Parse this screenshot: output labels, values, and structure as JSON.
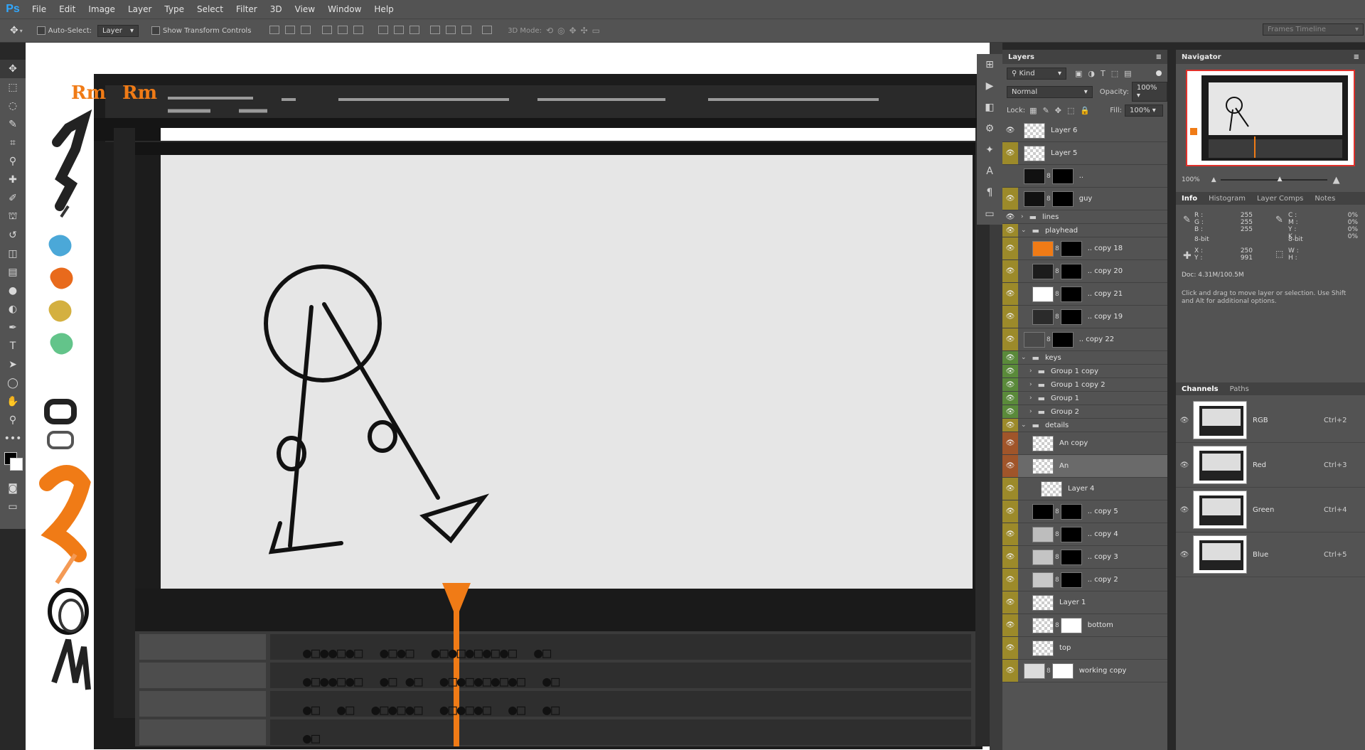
{
  "app": {
    "logo": "Ps"
  },
  "menu": [
    "File",
    "Edit",
    "Image",
    "Layer",
    "Type",
    "Select",
    "Filter",
    "3D",
    "View",
    "Window",
    "Help"
  ],
  "options": {
    "auto_select_label": "Auto-Select:",
    "auto_select_value": "Layer",
    "transform_label": "Show Transform Controls",
    "mode3d_label": "3D Mode:",
    "workspace": "Frames Timeline"
  },
  "layers_panel": {
    "title": "Layers",
    "kind_label": "Kind",
    "blend_mode": "Normal",
    "opacity_label": "Opacity:",
    "opacity_value": "100%",
    "lock_label": "Lock:",
    "fill_label": "Fill:",
    "fill_value": "100%",
    "rows": [
      {
        "name": "Layer 6",
        "indent": 0,
        "type": "layer",
        "thumb": "checker",
        "mask": "",
        "eye": true,
        "color": "#535353"
      },
      {
        "name": "Layer 5",
        "indent": 0,
        "type": "layer",
        "thumb": "checker",
        "mask": "",
        "eye": true,
        "color": "#9c8a2a"
      },
      {
        "name": "..",
        "indent": 0,
        "type": "layer",
        "thumb": "#111111",
        "mask": "#000000",
        "eye": false,
        "color": "#535353"
      },
      {
        "name": "guy",
        "indent": 0,
        "type": "layer",
        "thumb": "#111111",
        "mask": "#000000",
        "eye": true,
        "color": "#9c8a2a"
      },
      {
        "name": "lines",
        "indent": 0,
        "type": "group",
        "eye": true,
        "color": "#535353"
      },
      {
        "name": "playhead",
        "indent": 0,
        "type": "group-open",
        "eye": true,
        "color": "#9c8a2a"
      },
      {
        "name": ".. copy 18",
        "indent": 1,
        "type": "layer",
        "thumb": "#f07b16",
        "mask": "#000000",
        "eye": true,
        "color": "#9c8a2a"
      },
      {
        "name": ".. copy 20",
        "indent": 1,
        "type": "layer",
        "thumb": "#1c1c1c",
        "mask": "#000000",
        "eye": true,
        "color": "#9c8a2a"
      },
      {
        "name": ".. copy 21",
        "indent": 1,
        "type": "layer",
        "thumb": "#ffffff",
        "mask": "#000000",
        "eye": true,
        "color": "#9c8a2a"
      },
      {
        "name": ".. copy 19",
        "indent": 1,
        "type": "layer",
        "thumb": "#2b2b2b",
        "mask": "#000000",
        "eye": true,
        "color": "#9c8a2a"
      },
      {
        "name": ".. copy 22",
        "indent": 0,
        "type": "layer",
        "thumb": "#4a4a4a",
        "mask": "#000000",
        "eye": true,
        "color": "#9c8a2a"
      },
      {
        "name": "keys",
        "indent": 0,
        "type": "group-open",
        "eye": true,
        "color": "#5a8a3a"
      },
      {
        "name": "Group 1 copy",
        "indent": 1,
        "type": "group",
        "eye": true,
        "color": "#5a8a3a"
      },
      {
        "name": "Group 1 copy 2",
        "indent": 1,
        "type": "group",
        "eye": true,
        "color": "#5a8a3a"
      },
      {
        "name": "Group 1",
        "indent": 1,
        "type": "group",
        "eye": true,
        "color": "#5a8a3a"
      },
      {
        "name": "Group 2",
        "indent": 1,
        "type": "group",
        "eye": true,
        "color": "#5a8a3a"
      },
      {
        "name": "details",
        "indent": 0,
        "type": "group-open",
        "eye": true,
        "color": "#9c8a2a"
      },
      {
        "name": "An copy",
        "indent": 1,
        "type": "layer",
        "thumb": "checker",
        "mask": "",
        "eye": true,
        "color": "#a0552a"
      },
      {
        "name": "An",
        "indent": 1,
        "type": "layer",
        "thumb": "checker",
        "mask": "",
        "eye": true,
        "color": "#a0552a",
        "selected": true
      },
      {
        "name": "Layer 4",
        "indent": 2,
        "type": "layer",
        "thumb": "checker",
        "mask": "",
        "eye": true,
        "color": "#9c8a2a"
      },
      {
        "name": ".. copy 5",
        "indent": 1,
        "type": "layer",
        "thumb": "#000000",
        "mask": "#000000",
        "eye": true,
        "color": "#9c8a2a"
      },
      {
        "name": ".. copy 4",
        "indent": 1,
        "type": "layer",
        "thumb": "#bdbdbd",
        "mask": "#000000",
        "eye": true,
        "color": "#9c8a2a"
      },
      {
        "name": ".. copy 3",
        "indent": 1,
        "type": "layer",
        "thumb": "#c4c4c4",
        "mask": "#000000",
        "eye": true,
        "color": "#9c8a2a"
      },
      {
        "name": ".. copy 2",
        "indent": 1,
        "type": "layer",
        "thumb": "#c8c8c8",
        "mask": "#000000",
        "eye": true,
        "color": "#9c8a2a"
      },
      {
        "name": "Layer 1",
        "indent": 1,
        "type": "layer",
        "thumb": "checker",
        "mask": "",
        "eye": true,
        "color": "#9c8a2a"
      },
      {
        "name": "bottom",
        "indent": 1,
        "type": "layer",
        "thumb": "checker",
        "mask": "#ffffff",
        "eye": true,
        "color": "#9c8a2a"
      },
      {
        "name": "top",
        "indent": 1,
        "type": "layer",
        "thumb": "checker",
        "mask": "",
        "eye": true,
        "color": "#9c8a2a"
      },
      {
        "name": "working copy",
        "indent": 0,
        "type": "layer",
        "thumb": "#dcdcdc",
        "mask": "#ffffff",
        "eye": true,
        "color": "#9c8a2a"
      }
    ]
  },
  "navigator": {
    "title": "Navigator",
    "zoom": "100%"
  },
  "info": {
    "tabs": [
      "Info",
      "Histogram",
      "Layer Comps",
      "Notes"
    ],
    "rgb_labels": [
      "R :",
      "G :",
      "B :"
    ],
    "rgb_values": [
      "255",
      "255",
      "255"
    ],
    "cmyk_labels": [
      "C :",
      "M :",
      "Y :",
      "K :"
    ],
    "cmyk_values": [
      "0%",
      "0%",
      "0%",
      "0%"
    ],
    "bitdepth_left": "8-bit",
    "bitdepth_right": "8-bit",
    "xy_labels": [
      "X :",
      "Y :"
    ],
    "xy_values": [
      "250",
      "991"
    ],
    "wh_labels": [
      "W :",
      "H :"
    ],
    "doc": "Doc: 4.31M/100.5M",
    "hint": "Click and drag to move layer or selection.  Use Shift and Alt for additional options."
  },
  "channels": {
    "tabs": [
      "Channels",
      "Paths"
    ],
    "rows": [
      {
        "name": "RGB",
        "shortcut": "Ctrl+2"
      },
      {
        "name": "Red",
        "shortcut": "Ctrl+3"
      },
      {
        "name": "Green",
        "shortcut": "Ctrl+4"
      },
      {
        "name": "Blue",
        "shortcut": "Ctrl+5"
      }
    ]
  },
  "canvas": {
    "stamp_left": "Rm",
    "stamp_right": "Rm",
    "accent": "#f07b16",
    "swatch_colors": [
      "#4ba8d8",
      "#e86a1c",
      "#d4b040",
      "#63c48a"
    ],
    "timeline_rows": [
      "●□●●□●□  ●□●□  ●□●□●□●□●□  ●□",
      "●□●●□●□  ●□ ●□  ●□●□●□●□●□  ●□",
      "●□  ●□  ●□●□●□  ●□●□●□  ●□  ●□",
      "●□"
    ]
  }
}
